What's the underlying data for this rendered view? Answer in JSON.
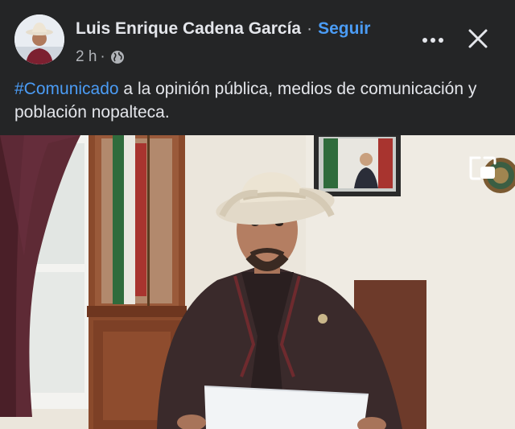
{
  "post": {
    "author_name": "Luis Enrique Cadena García",
    "separator": "·",
    "follow_label": "Seguir",
    "time": "2 h",
    "time_separator": "·",
    "privacy_icon": "globe-icon",
    "hashtag": "#Comunicado",
    "body_text": " a la opinión pública, medios de comunicación y población nopalteca."
  },
  "actions": {
    "more_icon": "more-icon",
    "close_icon": "close-icon",
    "pip_icon": "picture-in-picture-icon"
  },
  "colors": {
    "background": "#242526",
    "text": "#e4e6eb",
    "secondary_text": "#b0b3b8",
    "link": "#4b9cf5"
  }
}
